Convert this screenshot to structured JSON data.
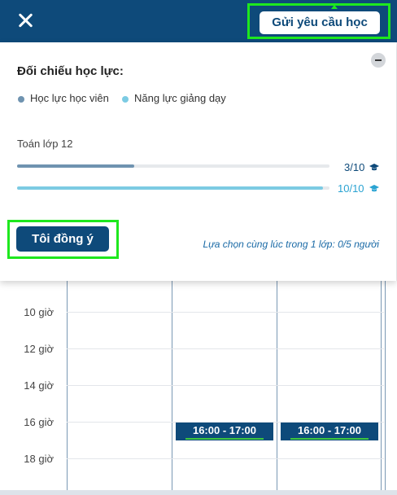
{
  "header": {
    "close_icon": "close-icon",
    "request_button_label": "Gửi yêu cầu học",
    "background_color": "#0e4a7a"
  },
  "comparison": {
    "title": "Đối chiếu học lực:",
    "collapse_icon": "minus-circle-icon",
    "legend": [
      {
        "label": "Học lực học viên",
        "color": "#6f93b0"
      },
      {
        "label": "Năng lực giảng dạy",
        "color": "#7ccbe3"
      }
    ],
    "subject": "Toán lớp 12",
    "bars": [
      {
        "score_text": "3/10",
        "value": 3,
        "max": 10,
        "color": "#6f93b0",
        "text_color": "#0e4a7a",
        "icon": "graduation-cap-icon"
      },
      {
        "score_text": "10/10",
        "value": 10,
        "max": 10,
        "color": "#7ccbe3",
        "text_color": "#2aa3d2",
        "icon": "graduation-cap-icon"
      }
    ],
    "agree_button_label": "Tôi đồng ý",
    "note": "Lựa chọn cùng lúc trong 1 lớp: 0/5 người"
  },
  "schedule": {
    "times": [
      "10 giờ",
      "12 giờ",
      "14 giờ",
      "16 giờ",
      "18 giờ"
    ],
    "slots": [
      {
        "label": "16:00 - 17:00"
      },
      {
        "label": "16:00 - 17:00"
      }
    ]
  }
}
